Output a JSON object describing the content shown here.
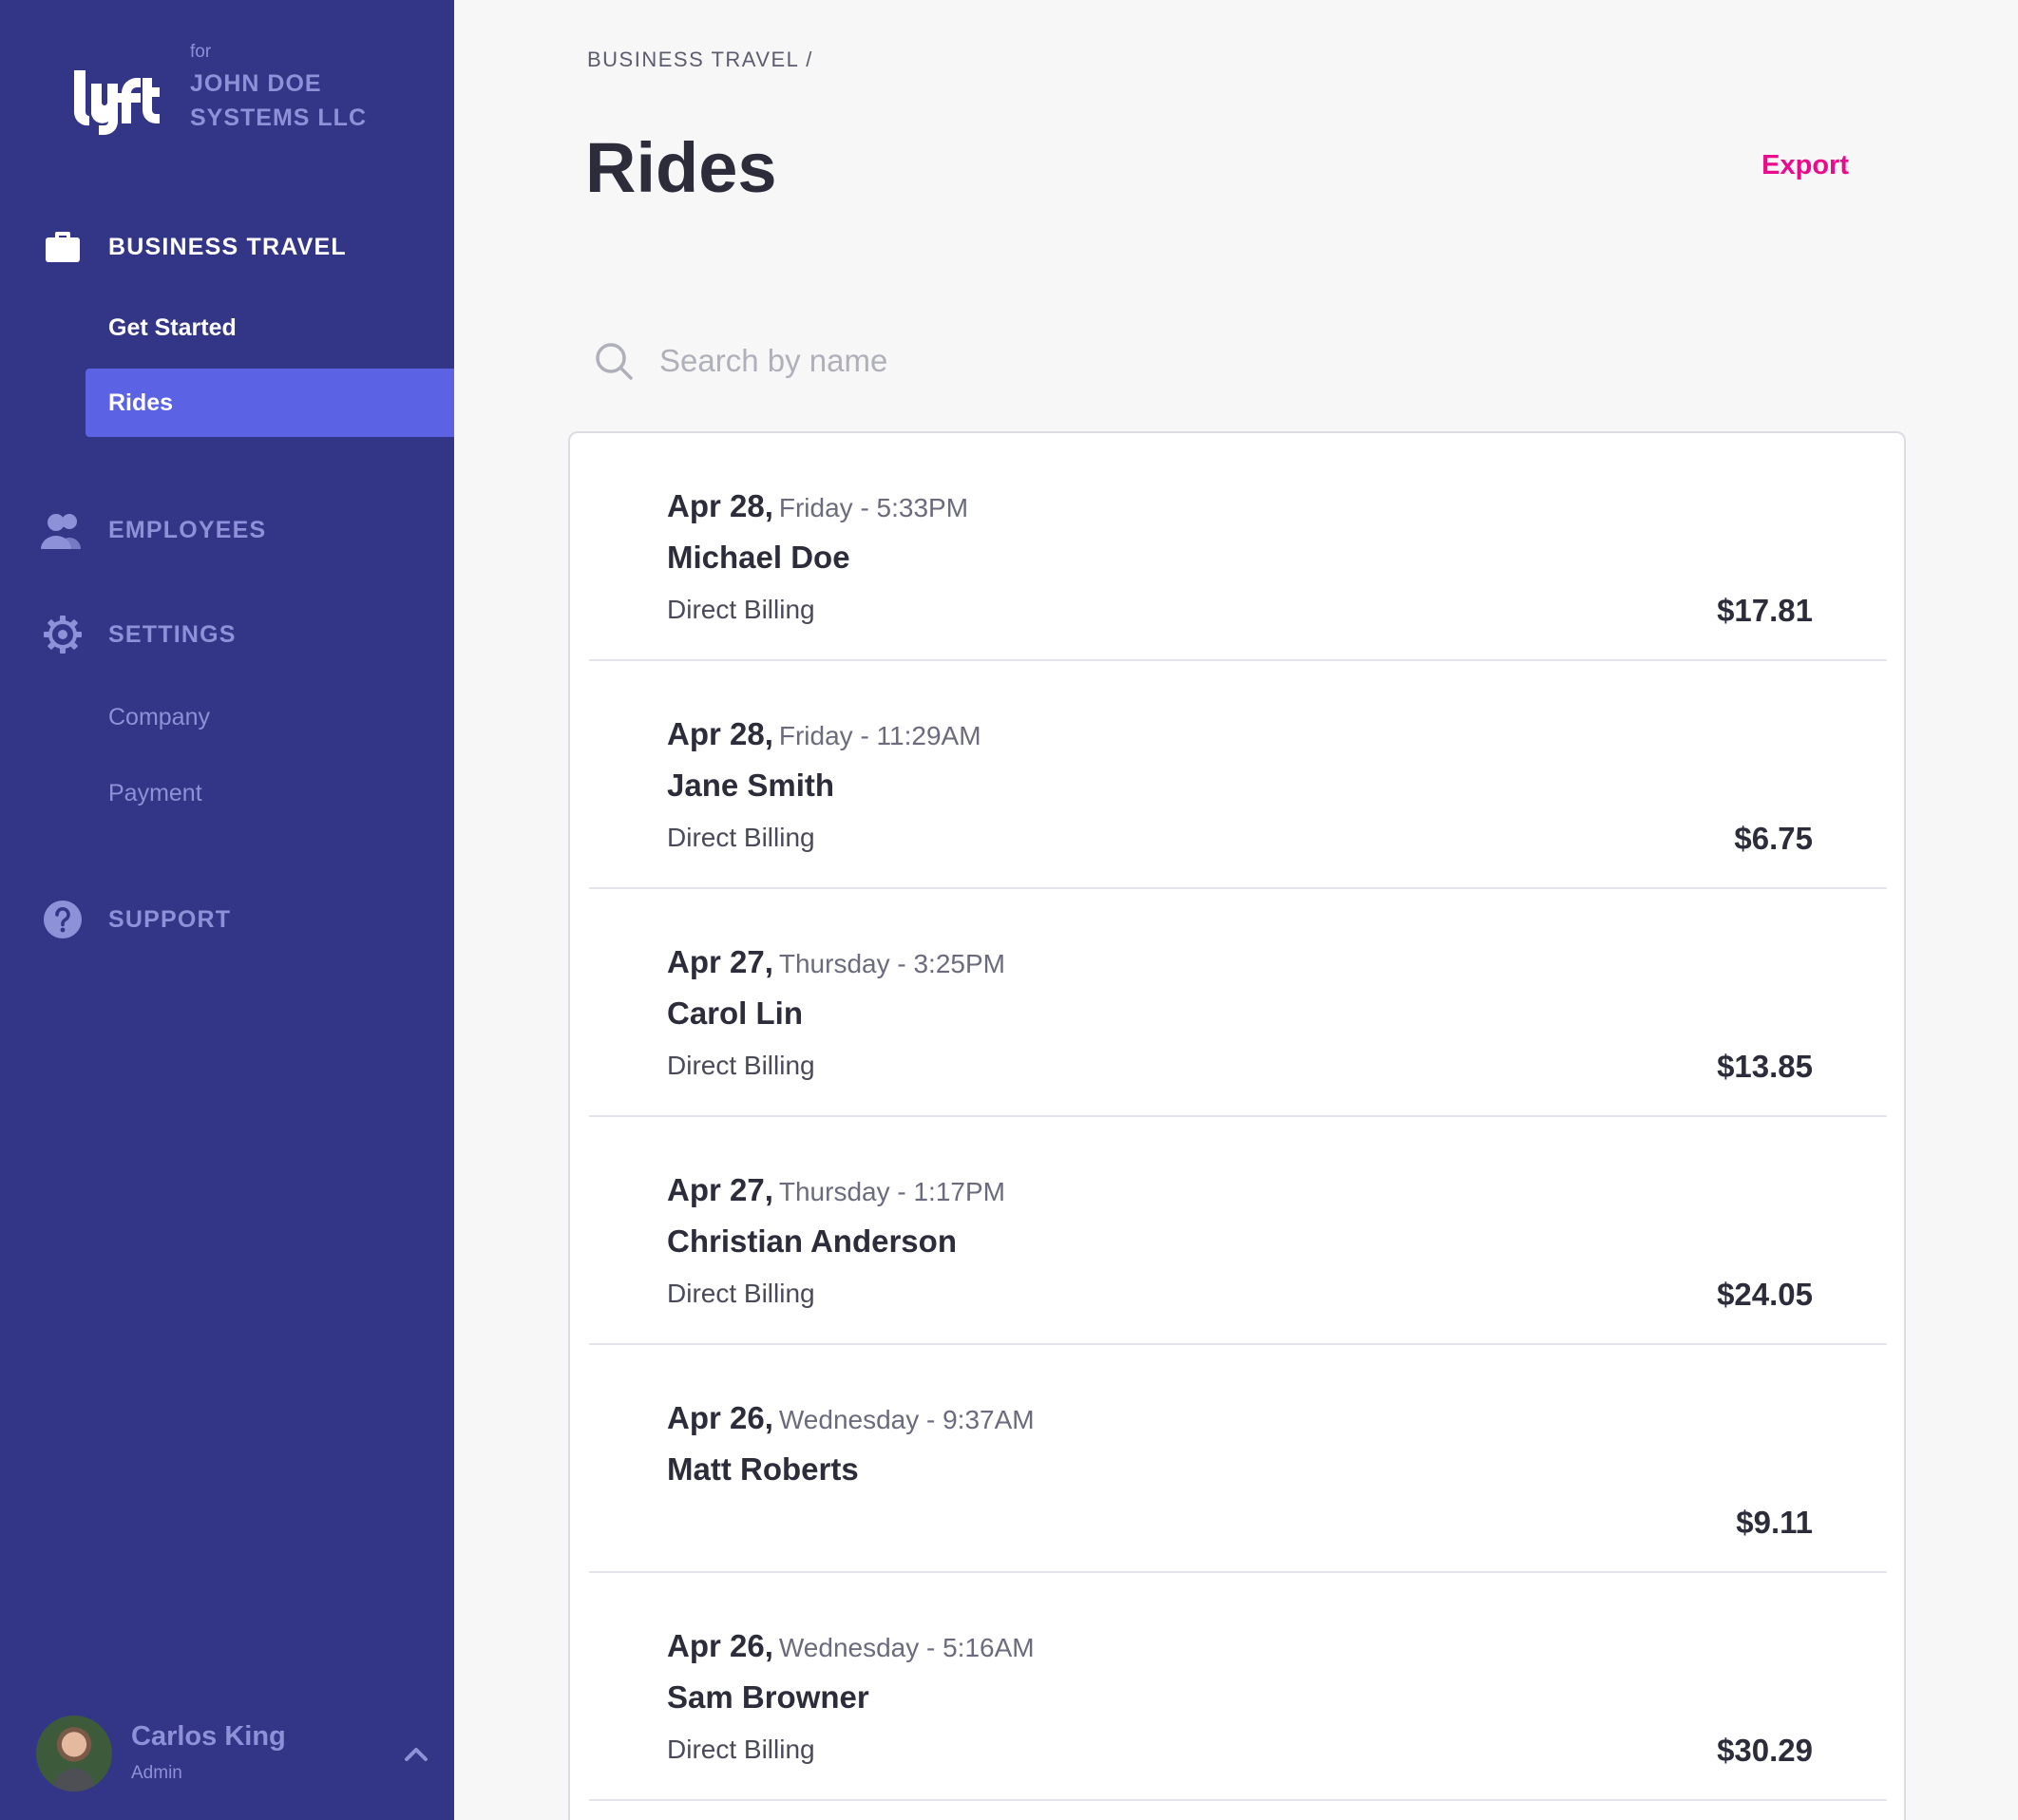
{
  "brand": {
    "for_label": "for",
    "company_line1": "JOHN DOE",
    "company_line2": "SYSTEMS LLC"
  },
  "sidebar": {
    "business_travel": "BUSINESS TRAVEL",
    "get_started": "Get Started",
    "rides": "Rides",
    "employees": "EMPLOYEES",
    "settings": "SETTINGS",
    "company": "Company",
    "payment": "Payment",
    "support": "SUPPORT"
  },
  "user": {
    "name": "Carlos King",
    "role": "Admin"
  },
  "main": {
    "breadcrumb": "BUSINESS TRAVEL /",
    "title": "Rides",
    "export_label": "Export",
    "search_placeholder": "Search by name"
  },
  "rides": [
    {
      "date": "Apr 28,",
      "day_time": "Friday - 5:33PM",
      "name": "Michael Doe",
      "billing": "Direct Billing",
      "price": "$17.81"
    },
    {
      "date": "Apr 28,",
      "day_time": "Friday - 11:29AM",
      "name": "Jane Smith",
      "billing": "Direct Billing",
      "price": "$6.75"
    },
    {
      "date": "Apr 27,",
      "day_time": "Thursday - 3:25PM",
      "name": "Carol Lin",
      "billing": "Direct Billing",
      "price": "$13.85"
    },
    {
      "date": "Apr 27,",
      "day_time": "Thursday - 1:17PM",
      "name": "Christian Anderson",
      "billing": "Direct Billing",
      "price": "$24.05"
    },
    {
      "date": "Apr 26,",
      "day_time": "Wednesday - 9:37AM",
      "name": "Matt Roberts",
      "billing": "",
      "price": "$9.11"
    },
    {
      "date": "Apr 26,",
      "day_time": "Wednesday - 5:16AM",
      "name": "Sam Browner",
      "billing": "Direct Billing",
      "price": "$30.29"
    }
  ],
  "colors": {
    "sidebar_bg": "#333586",
    "sidebar_selected": "#5b63e4",
    "sidebar_dim_text": "#8d91d8",
    "accent": "#ea0b8c"
  },
  "icons": {
    "business_travel": "briefcase-icon",
    "employees": "people-icon",
    "settings": "gear-icon",
    "support": "question-icon",
    "search": "search-icon",
    "user_menu": "chevron-up-icon"
  }
}
